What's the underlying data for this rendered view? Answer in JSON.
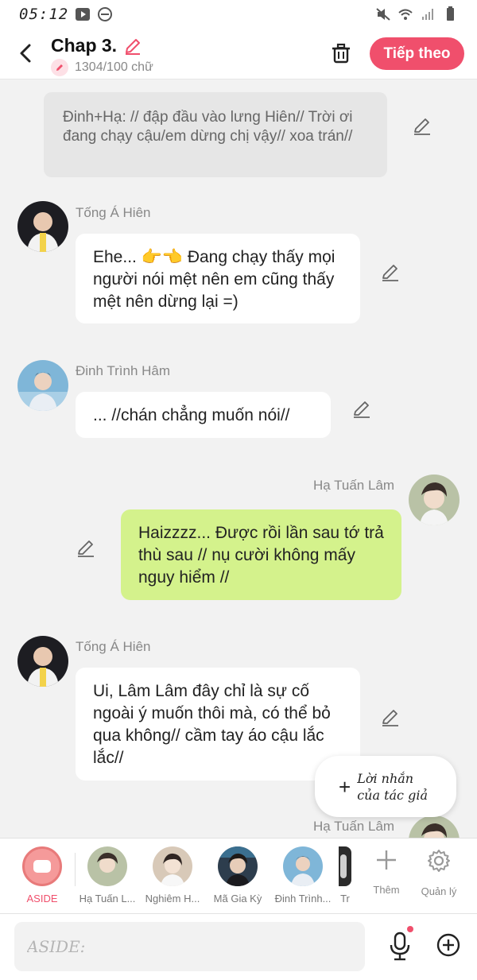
{
  "status_bar": {
    "time": "05:12"
  },
  "header": {
    "title": "Chap 3.",
    "word_count": "1304/100 chữ",
    "next_button": "Tiếp theo",
    "accent": "#f04f6c"
  },
  "messages": {
    "narration": "Đinh+Hạ: // đập đầu vào lưng Hiên// Trời ơi đang chạy cậu/em dừng chị vậy// xoa trán//",
    "m1": {
      "name": "Tống Á Hiên",
      "text": "Ehe... 👉👈 Đang chạy thấy mọi người nói mệt nên em cũng thấy mệt nên dừng lại =)"
    },
    "m2": {
      "name": "Đinh Trình Hâm",
      "text": "... //chán chẳng muốn nói//"
    },
    "m3": {
      "name": "Hạ Tuấn Lâm",
      "text": "Haizzzz... Được rồi lần sau tớ trả thù sau // nụ cười không mấy nguy hiểm //",
      "bubble_color": "#d4f28c"
    },
    "m4": {
      "name": "Tống Á Hiên",
      "text": "Ui, Lâm Lâm đây chỉ là sự cố ngoài ý muốn thôi mà, có thể bỏ qua không// cầm tay áo cậu lắc lắc//"
    },
    "m5": {
      "name": "Hạ Tuấn Lâm"
    }
  },
  "author_note": {
    "label_line1": "Lời nhắn",
    "label_line2": "của tác giả"
  },
  "character_bar": {
    "aside_label": "ASIDE",
    "characters": [
      "Hạ Tuấn L...",
      "Nghiêm H...",
      "Mã Gia Kỳ",
      "Đinh Trình...",
      "Tr"
    ],
    "add_label": "Thêm",
    "manage_label": "Quản lý"
  },
  "input": {
    "placeholder": "ASIDE:"
  }
}
